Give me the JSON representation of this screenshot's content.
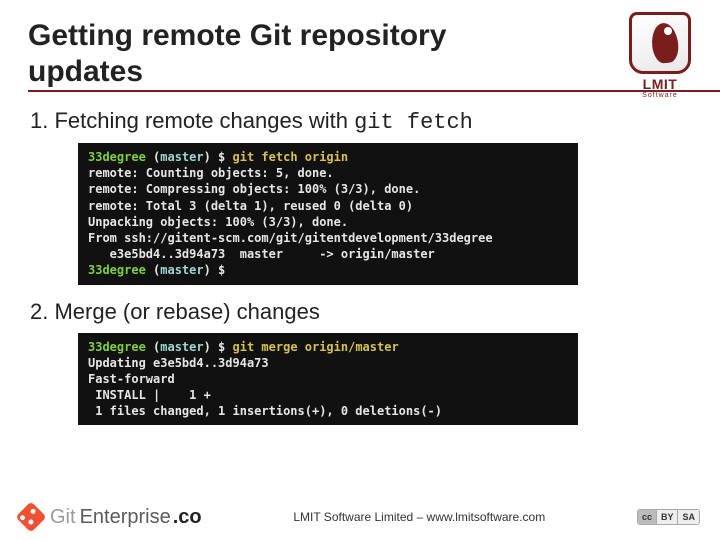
{
  "header": {
    "title": "Getting remote Git repository updates",
    "logo_text": "LMIT",
    "logo_sub": "Software"
  },
  "items": [
    {
      "number": "1.",
      "text": "Fetching remote changes with ",
      "code": "git fetch",
      "terminal": [
        {
          "segments": [
            {
              "c": "green",
              "t": "33degree"
            },
            {
              "c": "white",
              "t": " ("
            },
            {
              "c": "cyan",
              "t": "master"
            },
            {
              "c": "white",
              "t": ") $ "
            },
            {
              "c": "yellow",
              "t": "git fetch origin"
            }
          ]
        },
        {
          "segments": [
            {
              "c": "white",
              "t": "remote: Counting objects: 5, done."
            }
          ]
        },
        {
          "segments": [
            {
              "c": "white",
              "t": "remote: Compressing objects: 100% (3/3), done."
            }
          ]
        },
        {
          "segments": [
            {
              "c": "white",
              "t": "remote: Total 3 (delta 1), reused 0 (delta 0)"
            }
          ]
        },
        {
          "segments": [
            {
              "c": "white",
              "t": "Unpacking objects: 100% (3/3), done."
            }
          ]
        },
        {
          "segments": [
            {
              "c": "white",
              "t": "From ssh://gitent-scm.com/git/gitentdevelopment/33degree"
            }
          ]
        },
        {
          "segments": [
            {
              "c": "white",
              "t": "   e3e5bd4..3d94a73  master     -> origin/master"
            }
          ]
        },
        {
          "segments": [
            {
              "c": "green",
              "t": "33degree"
            },
            {
              "c": "white",
              "t": " ("
            },
            {
              "c": "cyan",
              "t": "master"
            },
            {
              "c": "white",
              "t": ") $ "
            }
          ]
        }
      ]
    },
    {
      "number": "2.",
      "text": "Merge (or rebase) changes",
      "code": "",
      "terminal": [
        {
          "segments": [
            {
              "c": "green",
              "t": "33degree"
            },
            {
              "c": "white",
              "t": " ("
            },
            {
              "c": "cyan",
              "t": "master"
            },
            {
              "c": "white",
              "t": ") $ "
            },
            {
              "c": "yellow",
              "t": "git merge origin/master"
            }
          ]
        },
        {
          "segments": [
            {
              "c": "white",
              "t": "Updating e3e5bd4..3d94a73"
            }
          ]
        },
        {
          "segments": [
            {
              "c": "white",
              "t": "Fast-forward"
            }
          ]
        },
        {
          "segments": [
            {
              "c": "white",
              "t": " INSTALL |    1 +"
            }
          ]
        },
        {
          "segments": [
            {
              "c": "white",
              "t": " 1 files changed, 1 insertions(+), 0 deletions(-)"
            }
          ]
        }
      ]
    }
  ],
  "footer": {
    "brand_git": "Git",
    "brand_ent": "Enterprise",
    "brand_co": ".co",
    "line": "LMIT Software Limited – www.lmitsoftware.com",
    "cc": [
      "cc",
      "BY",
      "SA"
    ]
  }
}
